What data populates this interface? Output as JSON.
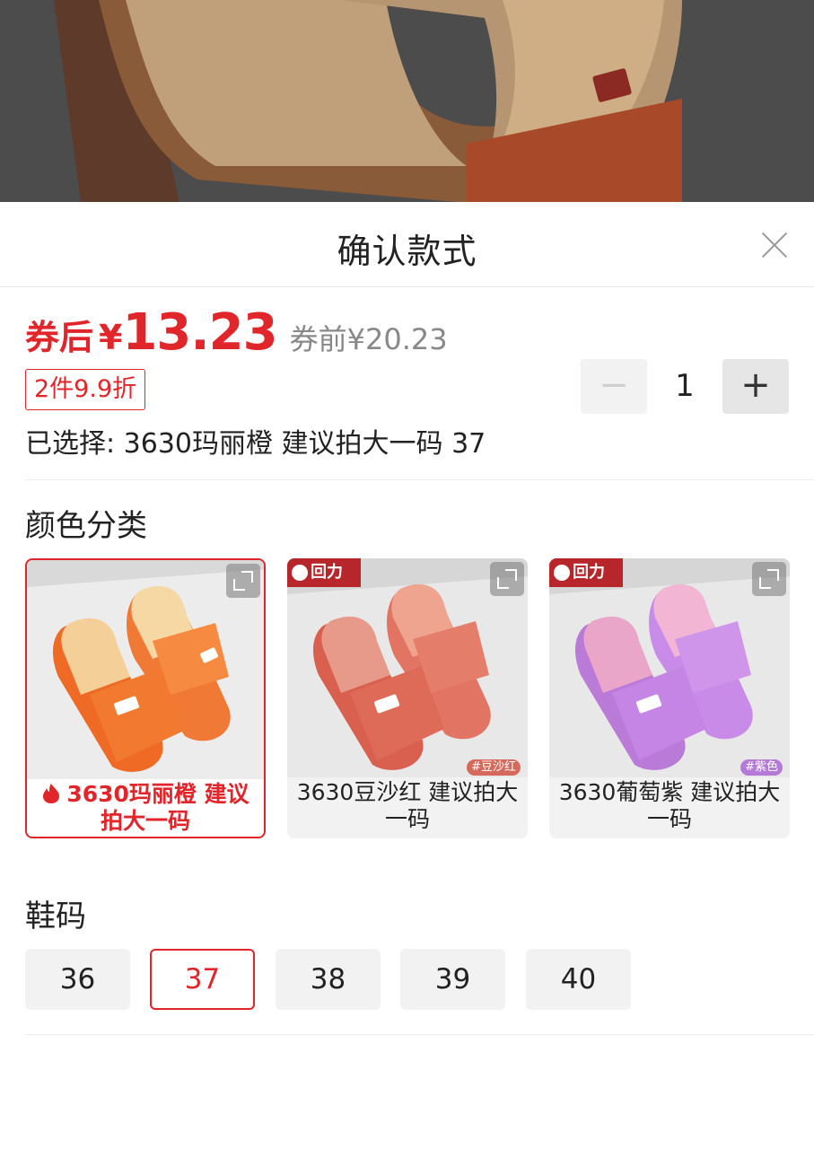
{
  "header": {
    "title": "确认款式"
  },
  "price": {
    "prefix": "券后",
    "currency": "¥",
    "value": "13.23",
    "original": "券前¥20.23"
  },
  "promo_tag": "2件9.9折",
  "quantity": {
    "minus": "−",
    "value": "1",
    "plus": "+"
  },
  "selected": "已选择: 3630玛丽橙 建议拍大一码 37",
  "color_section": {
    "title": "颜色分类",
    "options": [
      {
        "label": "3630玛丽橙 建议拍大一码",
        "selected": true,
        "color_main": "#f07a35",
        "color_inner": "#f6d8a4"
      },
      {
        "label": "3630豆沙红 建议拍大一码",
        "selected": false,
        "badge": "回力",
        "tag": "#豆沙红",
        "color_main": "#e27463",
        "color_inner": "#efa48f"
      },
      {
        "label": "3630葡萄紫 建议拍大一码",
        "selected": false,
        "badge": "回力",
        "tag": "#紫色",
        "color_main": "#c98be8",
        "color_inner": "#f2b6d4"
      }
    ]
  },
  "size_section": {
    "title": "鞋码",
    "options": [
      "36",
      "37",
      "38",
      "39",
      "40"
    ],
    "selected": "37"
  },
  "colors": {
    "accent": "#e0262b"
  }
}
